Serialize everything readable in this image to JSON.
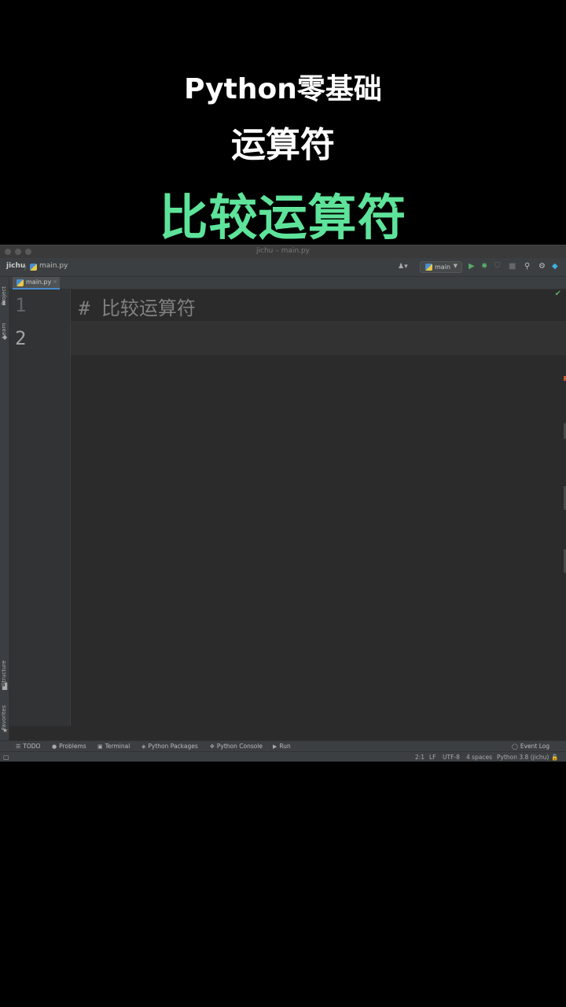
{
  "overlay": {
    "line1": "Python零基础",
    "line2": "运算符",
    "line3": "比较运算符",
    "accent_color": "#5ee39a"
  },
  "window": {
    "title": "jichu – main.py"
  },
  "navbar": {
    "project": "jichu",
    "separator": "〉",
    "file": "main.py",
    "run_config": "main"
  },
  "tabs": [
    {
      "label": "main.py",
      "close": "×"
    }
  ],
  "left_tools": {
    "project": "Project",
    "learn": "Learn",
    "structure": "Structure",
    "favorites": "Favorites"
  },
  "editor": {
    "line_numbers": [
      "1",
      "2"
    ],
    "lines": [
      "#  比较运算符",
      ""
    ]
  },
  "tool_windows": {
    "todo": "TODO",
    "problems": "Problems",
    "terminal": "Terminal",
    "python_packages": "Python Packages",
    "python_console": "Python Console",
    "run": "Run",
    "event_log": "Event Log"
  },
  "status": {
    "position": "2:1",
    "line_sep": "LF",
    "encoding": "UTF-8",
    "indent": "4 spaces",
    "interpreter": "Python 3.8 (jichu)"
  },
  "icons": [
    "folder-icon",
    "learn-icon",
    "structure-icon",
    "star-icon",
    "run-icon",
    "debug-icon",
    "coverage-icon",
    "stop-icon",
    "search-icon",
    "gear-icon",
    "check-icon",
    "python-file-icon"
  ]
}
